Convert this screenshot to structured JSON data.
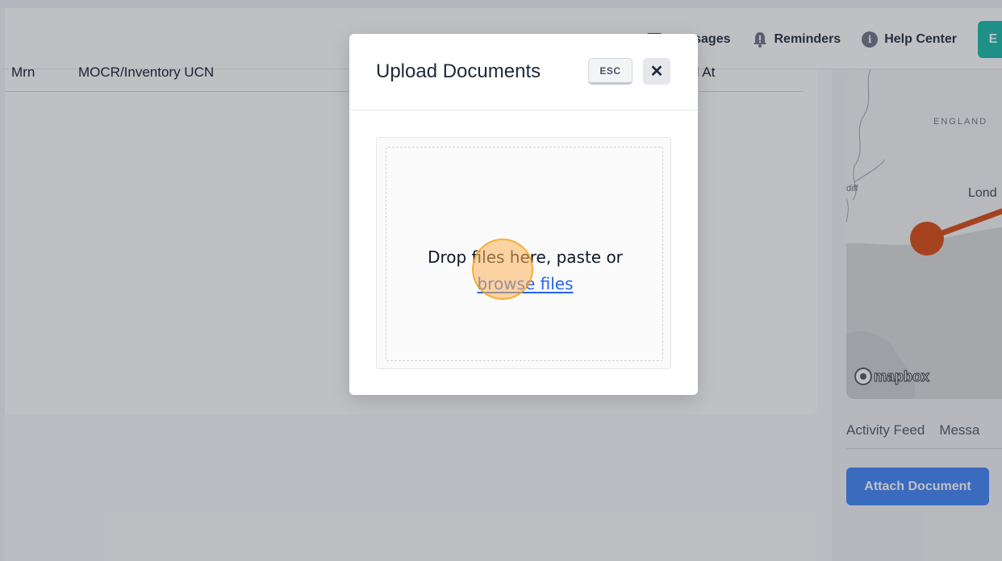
{
  "topnav": {
    "messages_label": "Messages",
    "reminders_label": "Reminders",
    "help_label": "Help Center",
    "teal_button_label": "E"
  },
  "table": {
    "headers": [
      "Mrn",
      "MOCR/Inventory UCN",
      "Created At"
    ]
  },
  "map": {
    "region_label": "ENGLAND",
    "city_label": "Lond",
    "city_small_label": "diff",
    "attribution": "mapbox"
  },
  "right_panel": {
    "tabs": [
      "Activity Feed",
      "Messa"
    ],
    "attach_button": "Attach Document"
  },
  "modal": {
    "title": "Upload Documents",
    "esc_label": "ESC",
    "close_symbol": "✕",
    "drop_text": "Drop files here, paste or",
    "browse_label": "browse files"
  },
  "colors": {
    "primary": "#3b82f6",
    "teal": "#14b8a6",
    "route": "#d9480f",
    "click_indicator": "#f59e0b"
  }
}
